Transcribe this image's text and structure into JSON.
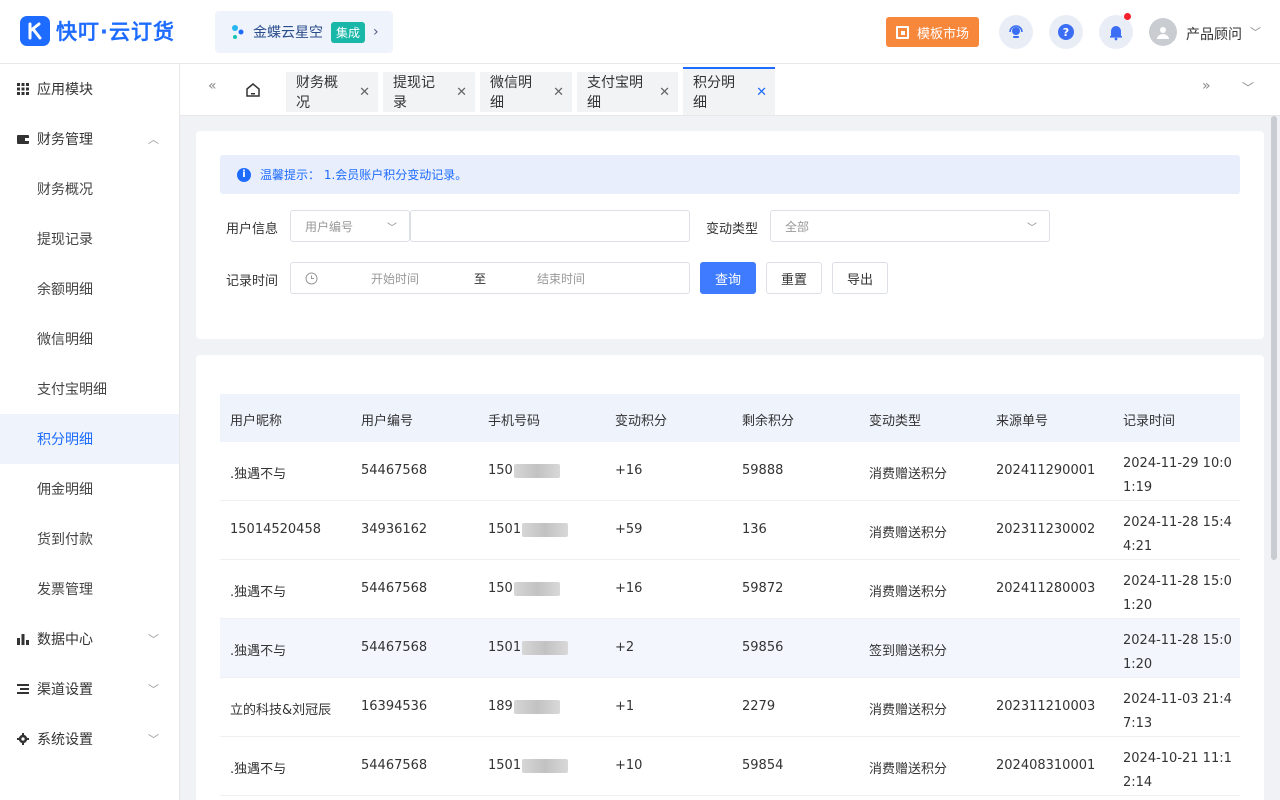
{
  "header": {
    "logo_text": "快叮·云订货",
    "integration_name": "金蝶云星空",
    "integration_badge": "集成",
    "template_market": "模板市场",
    "user_name": "产品顾问"
  },
  "sidebar": {
    "items": [
      {
        "label": "应用模块"
      },
      {
        "label": "财务管理"
      },
      {
        "label": "财务概况"
      },
      {
        "label": "提现记录"
      },
      {
        "label": "余额明细"
      },
      {
        "label": "微信明细"
      },
      {
        "label": "支付宝明细"
      },
      {
        "label": "积分明细"
      },
      {
        "label": "佣金明细"
      },
      {
        "label": "货到付款"
      },
      {
        "label": "发票管理"
      },
      {
        "label": "数据中心"
      },
      {
        "label": "渠道设置"
      },
      {
        "label": "系统设置"
      }
    ]
  },
  "tabs": [
    {
      "label": "财务概况"
    },
    {
      "label": "提现记录"
    },
    {
      "label": "微信明细"
    },
    {
      "label": "支付宝明细"
    },
    {
      "label": "积分明细"
    }
  ],
  "tip": "温馨提示： 1.会员账户积分变动记录。",
  "filters": {
    "user_info_label": "用户信息",
    "user_id_select": "用户编号",
    "change_type_label": "变动类型",
    "change_type_value": "全部",
    "record_time_label": "记录时间",
    "start_placeholder": "开始时间",
    "range_sep": "至",
    "end_placeholder": "结束时间",
    "query": "查询",
    "reset": "重置",
    "export": "导出"
  },
  "table": {
    "columns": [
      "用户昵称",
      "用户编号",
      "手机号码",
      "变动积分",
      "剩余积分",
      "变动类型",
      "来源单号",
      "记录时间"
    ],
    "rows": [
      {
        "nickname": ".独遇不与",
        "user_id": "54467568",
        "phone": "150",
        "change": "+16",
        "remaining": "59888",
        "type": "消费赠送积分",
        "source": "202411290001",
        "time": "2024-11-29 10:01:19"
      },
      {
        "nickname": "15014520458",
        "user_id": "34936162",
        "phone": "1501",
        "change": "+59",
        "remaining": "136",
        "type": "消费赠送积分",
        "source": "202311230002",
        "time": "2024-11-28 15:44:21"
      },
      {
        "nickname": ".独遇不与",
        "user_id": "54467568",
        "phone": "150",
        "change": "+16",
        "remaining": "59872",
        "type": "消费赠送积分",
        "source": "202411280003",
        "time": "2024-11-28 15:01:20"
      },
      {
        "nickname": ".独遇不与",
        "user_id": "54467568",
        "phone": "1501",
        "change": "+2",
        "remaining": "59856",
        "type": "签到赠送积分",
        "source": "",
        "time": "2024-11-28 15:01:20"
      },
      {
        "nickname": "立的科技&刘冠辰",
        "user_id": "16394536",
        "phone": "189",
        "change": "+1",
        "remaining": "2279",
        "type": "消费赠送积分",
        "source": "202311210003",
        "time": "2024-11-03 21:47:13"
      },
      {
        "nickname": ".独遇不与",
        "user_id": "54467568",
        "phone": "1501",
        "change": "+10",
        "remaining": "59854",
        "type": "消费赠送积分",
        "source": "202408310001",
        "time": "2024-10-21 11:12:14"
      }
    ]
  },
  "colors": {
    "accent": "#1e6cff",
    "orange": "#f7873a",
    "badge": "#19b7a8"
  }
}
